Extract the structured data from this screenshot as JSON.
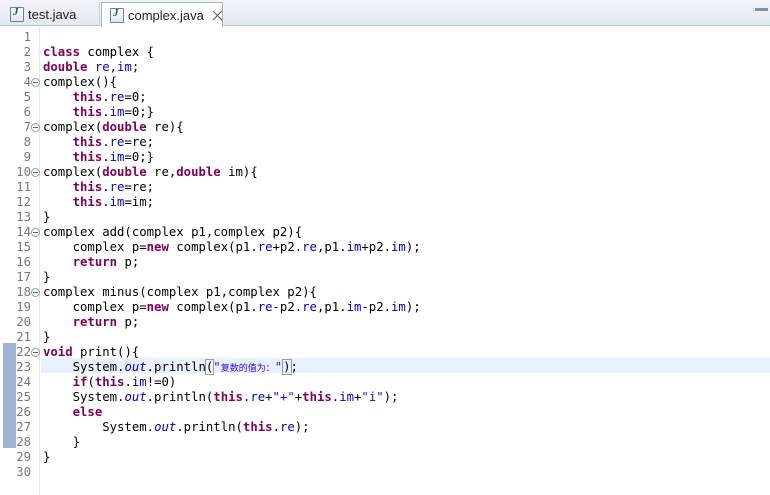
{
  "tabs": [
    {
      "label": "test.java",
      "active": false
    },
    {
      "label": "complex.java",
      "active": true
    }
  ],
  "icons": {
    "java_file": "java-file-icon",
    "close": "close-icon",
    "fold": "fold-collapse-icon"
  },
  "editor": {
    "current_line": 23,
    "lines": [
      {
        "n": "1",
        "tokens": []
      },
      {
        "n": "2",
        "tokens": [
          {
            "t": "class",
            "c": "kw"
          },
          {
            "t": " complex {",
            "c": ""
          }
        ]
      },
      {
        "n": "3",
        "tokens": [
          {
            "t": "double",
            "c": "kw"
          },
          {
            "t": " ",
            "c": ""
          },
          {
            "t": "re",
            "c": "fld"
          },
          {
            "t": ",",
            "c": ""
          },
          {
            "t": "im",
            "c": "fld"
          },
          {
            "t": ";",
            "c": ""
          }
        ]
      },
      {
        "n": "4",
        "fold": true,
        "tokens": [
          {
            "t": "complex(){",
            "c": ""
          }
        ]
      },
      {
        "n": "5",
        "tokens": [
          {
            "t": "    ",
            "c": ""
          },
          {
            "t": "this",
            "c": "kw"
          },
          {
            "t": ".",
            "c": ""
          },
          {
            "t": "re",
            "c": "fld"
          },
          {
            "t": "=0;",
            "c": ""
          }
        ]
      },
      {
        "n": "6",
        "tokens": [
          {
            "t": "    ",
            "c": ""
          },
          {
            "t": "this",
            "c": "kw"
          },
          {
            "t": ".",
            "c": ""
          },
          {
            "t": "im",
            "c": "fld"
          },
          {
            "t": "=0;}",
            "c": ""
          }
        ]
      },
      {
        "n": "7",
        "fold": true,
        "tokens": [
          {
            "t": "complex(",
            "c": ""
          },
          {
            "t": "double",
            "c": "kw"
          },
          {
            "t": " re){",
            "c": ""
          }
        ]
      },
      {
        "n": "8",
        "tokens": [
          {
            "t": "    ",
            "c": ""
          },
          {
            "t": "this",
            "c": "kw"
          },
          {
            "t": ".",
            "c": ""
          },
          {
            "t": "re",
            "c": "fld"
          },
          {
            "t": "=re;",
            "c": ""
          }
        ]
      },
      {
        "n": "9",
        "tokens": [
          {
            "t": "    ",
            "c": ""
          },
          {
            "t": "this",
            "c": "kw"
          },
          {
            "t": ".",
            "c": ""
          },
          {
            "t": "im",
            "c": "fld"
          },
          {
            "t": "=0;}",
            "c": ""
          }
        ]
      },
      {
        "n": "10",
        "fold": true,
        "tokens": [
          {
            "t": "complex(",
            "c": ""
          },
          {
            "t": "double",
            "c": "kw"
          },
          {
            "t": " re,",
            "c": ""
          },
          {
            "t": "double",
            "c": "kw"
          },
          {
            "t": " im){",
            "c": ""
          }
        ]
      },
      {
        "n": "11",
        "tokens": [
          {
            "t": "    ",
            "c": ""
          },
          {
            "t": "this",
            "c": "kw"
          },
          {
            "t": ".",
            "c": ""
          },
          {
            "t": "re",
            "c": "fld"
          },
          {
            "t": "=re;",
            "c": ""
          }
        ]
      },
      {
        "n": "12",
        "tokens": [
          {
            "t": "    ",
            "c": ""
          },
          {
            "t": "this",
            "c": "kw"
          },
          {
            "t": ".",
            "c": ""
          },
          {
            "t": "im",
            "c": "fld"
          },
          {
            "t": "=im;",
            "c": ""
          }
        ]
      },
      {
        "n": "13",
        "tokens": [
          {
            "t": "}",
            "c": ""
          }
        ]
      },
      {
        "n": "14",
        "fold": true,
        "tokens": [
          {
            "t": "complex add(complex p1,complex p2){",
            "c": ""
          }
        ]
      },
      {
        "n": "15",
        "tokens": [
          {
            "t": "    complex p=",
            "c": ""
          },
          {
            "t": "new",
            "c": "kw"
          },
          {
            "t": " complex(p1.",
            "c": ""
          },
          {
            "t": "re",
            "c": "fld"
          },
          {
            "t": "+p2.",
            "c": ""
          },
          {
            "t": "re",
            "c": "fld"
          },
          {
            "t": ",p1.",
            "c": ""
          },
          {
            "t": "im",
            "c": "fld"
          },
          {
            "t": "+p2.",
            "c": ""
          },
          {
            "t": "im",
            "c": "fld"
          },
          {
            "t": ");",
            "c": ""
          }
        ]
      },
      {
        "n": "16",
        "tokens": [
          {
            "t": "    ",
            "c": ""
          },
          {
            "t": "return",
            "c": "kw"
          },
          {
            "t": " p;",
            "c": ""
          }
        ]
      },
      {
        "n": "17",
        "tokens": [
          {
            "t": "}",
            "c": ""
          }
        ]
      },
      {
        "n": "18",
        "fold": true,
        "tokens": [
          {
            "t": "complex minus(complex p1,complex p2){",
            "c": ""
          }
        ]
      },
      {
        "n": "19",
        "tokens": [
          {
            "t": "    complex p=",
            "c": ""
          },
          {
            "t": "new",
            "c": "kw"
          },
          {
            "t": " complex(p1.",
            "c": ""
          },
          {
            "t": "re",
            "c": "fld"
          },
          {
            "t": "-p2.",
            "c": ""
          },
          {
            "t": "re",
            "c": "fld"
          },
          {
            "t": ",p1.",
            "c": ""
          },
          {
            "t": "im",
            "c": "fld"
          },
          {
            "t": "-p2.",
            "c": ""
          },
          {
            "t": "im",
            "c": "fld"
          },
          {
            "t": ");",
            "c": ""
          }
        ]
      },
      {
        "n": "20",
        "tokens": [
          {
            "t": "    ",
            "c": ""
          },
          {
            "t": "return",
            "c": "kw"
          },
          {
            "t": " p;",
            "c": ""
          }
        ]
      },
      {
        "n": "21",
        "tokens": [
          {
            "t": "}",
            "c": ""
          }
        ]
      },
      {
        "n": "22",
        "fold": true,
        "tokens": [
          {
            "t": "void",
            "c": "kw"
          },
          {
            "t": " print(){",
            "c": ""
          }
        ]
      },
      {
        "n": "23",
        "tokens": [
          {
            "t": "    System.",
            "c": ""
          },
          {
            "t": "out",
            "c": "sfld"
          },
          {
            "t": ".println",
            "c": ""
          },
          {
            "t": "(",
            "c": "bracket"
          },
          {
            "t": "\"",
            "c": "str"
          },
          {
            "t": "复数的值为：",
            "c": "str-cjk"
          },
          {
            "t": "\"",
            "c": "str"
          },
          {
            "t": "|",
            "c": "caret"
          },
          {
            "t": ")",
            "c": "bracket"
          },
          {
            "t": ";",
            "c": ""
          }
        ]
      },
      {
        "n": "24",
        "tokens": [
          {
            "t": "    ",
            "c": ""
          },
          {
            "t": "if",
            "c": "kw"
          },
          {
            "t": "(",
            "c": ""
          },
          {
            "t": "this",
            "c": "kw"
          },
          {
            "t": ".",
            "c": ""
          },
          {
            "t": "im",
            "c": "fld"
          },
          {
            "t": "!=0)",
            "c": ""
          }
        ]
      },
      {
        "n": "25",
        "tokens": [
          {
            "t": "    System.",
            "c": ""
          },
          {
            "t": "out",
            "c": "sfld"
          },
          {
            "t": ".println(",
            "c": ""
          },
          {
            "t": "this",
            "c": "kw"
          },
          {
            "t": ".",
            "c": ""
          },
          {
            "t": "re",
            "c": "fld"
          },
          {
            "t": "+",
            "c": ""
          },
          {
            "t": "\"+\"",
            "c": "str"
          },
          {
            "t": "+",
            "c": ""
          },
          {
            "t": "this",
            "c": "kw"
          },
          {
            "t": ".",
            "c": ""
          },
          {
            "t": "im",
            "c": "fld"
          },
          {
            "t": "+",
            "c": ""
          },
          {
            "t": "\"i\"",
            "c": "str"
          },
          {
            "t": ");",
            "c": ""
          }
        ]
      },
      {
        "n": "26",
        "tokens": [
          {
            "t": "    ",
            "c": ""
          },
          {
            "t": "else",
            "c": "kw"
          }
        ]
      },
      {
        "n": "27",
        "tokens": [
          {
            "t": "        System.",
            "c": ""
          },
          {
            "t": "out",
            "c": "sfld"
          },
          {
            "t": ".println(",
            "c": ""
          },
          {
            "t": "this",
            "c": "kw"
          },
          {
            "t": ".",
            "c": ""
          },
          {
            "t": "re",
            "c": "fld"
          },
          {
            "t": ");",
            "c": ""
          }
        ]
      },
      {
        "n": "28",
        "tokens": [
          {
            "t": "    }",
            "c": ""
          }
        ]
      },
      {
        "n": "29",
        "tokens": [
          {
            "t": "}",
            "c": ""
          }
        ]
      },
      {
        "n": "30",
        "tokens": []
      }
    ]
  }
}
